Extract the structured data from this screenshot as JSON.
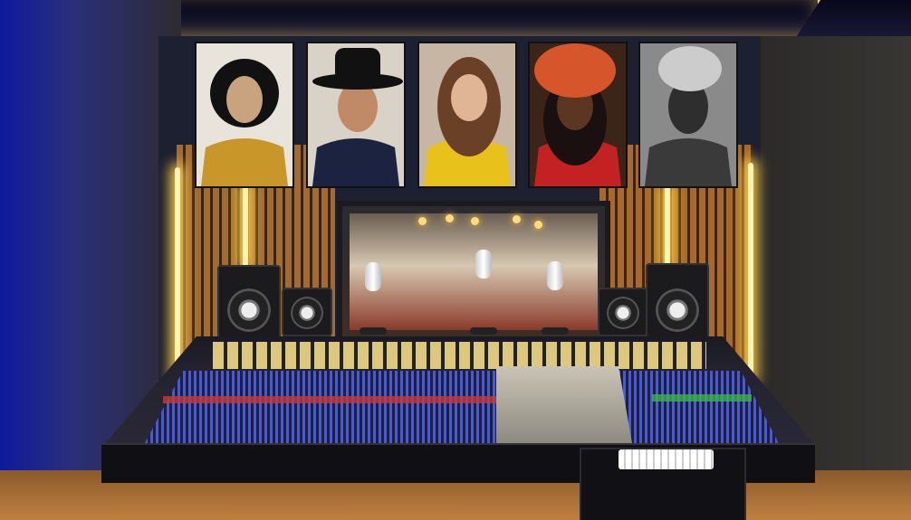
{
  "scene": {
    "kind": "recording-studio-photo",
    "colors": {
      "led_strip": "#ffcc44",
      "wall_blue": "#0d1a9c",
      "wood": "#a46a2e",
      "floor": "#c08040"
    }
  },
  "portraits": [
    {
      "bg": "#e8e4dc",
      "shirt": "#c9962a",
      "hair": "#111111",
      "skin": "#c9a27e",
      "hat": ""
    },
    {
      "bg": "#d9d2c6",
      "shirt": "#1b2340",
      "hair": "#1a1a1a",
      "skin": "#c08a66",
      "hat": "#111111"
    },
    {
      "bg": "#c8b6a4",
      "shirt": "#e8c21a",
      "hair": "#6a4126",
      "skin": "#e0b596",
      "hat": ""
    },
    {
      "bg": "#3b2418",
      "shirt": "#c42222",
      "hair": "#1a1010",
      "skin": "#5c3620",
      "hat": "#d6552a"
    },
    {
      "bg": "#8a8a8a",
      "shirt": "#3a3a3a",
      "hair": "#222222",
      "skin": "#2e2e2e",
      "hat": "#cccccc"
    }
  ]
}
